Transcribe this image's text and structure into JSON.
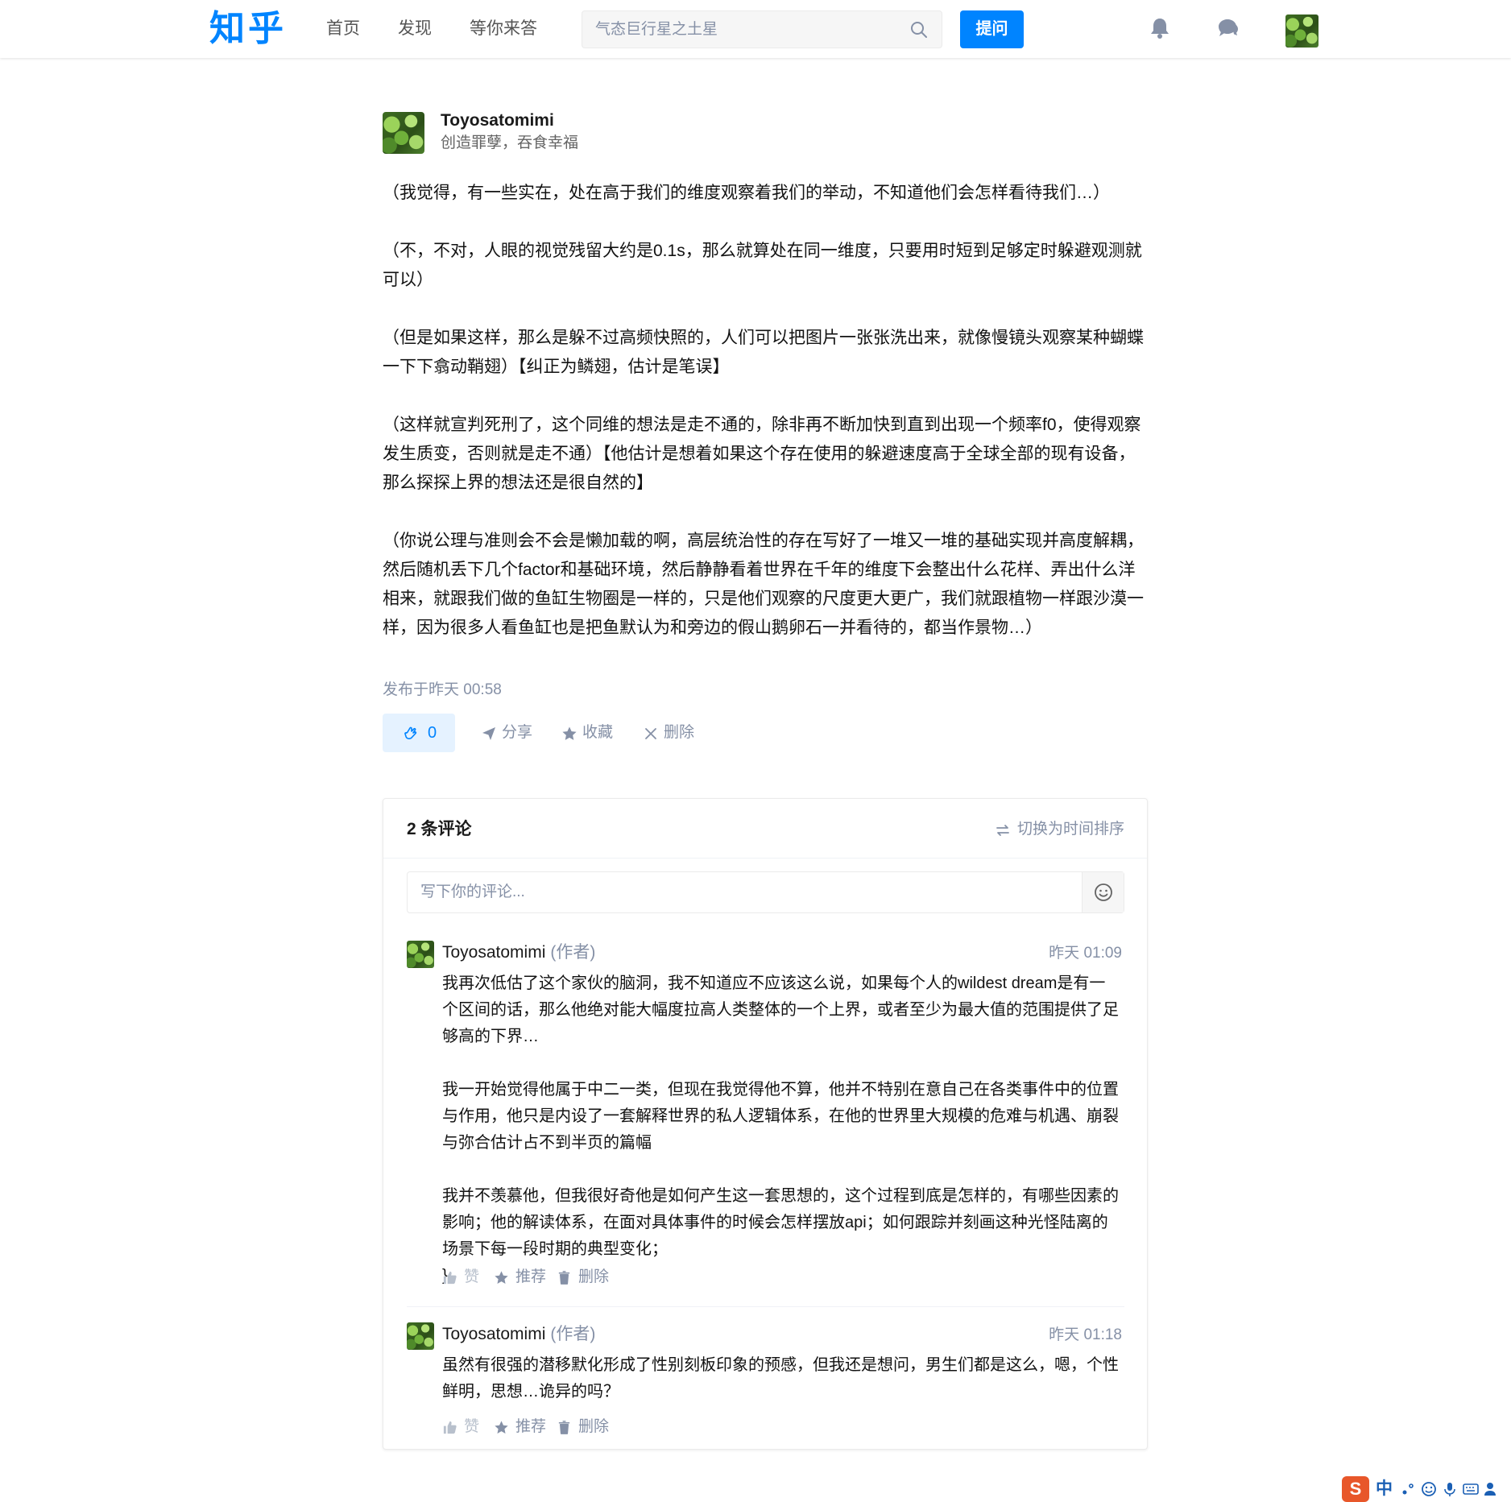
{
  "nav": {
    "logo": "知乎",
    "links": [
      "首页",
      "发现",
      "等你来答"
    ],
    "search_placeholder": "气态巨行星之土星",
    "ask_label": "提问",
    "icons": [
      "bell-icon",
      "chat-icon"
    ]
  },
  "post": {
    "author_name": "Toyosatomimi",
    "author_bio": "创造罪孽，吞食幸福",
    "paragraphs": [
      "（我觉得，有一些实在，处在高于我们的维度观察着我们的举动，不知道他们会怎样看待我们…）",
      "（不，不对，人眼的视觉残留大约是0.1s，那么就算处在同一维度，只要用时短到足够定时躲避观测就可以）",
      "（但是如果这样，那么是躲不过高频快照的，人们可以把图片一张张洗出来，就像慢镜头观察某种蝴蝶一下下翕动鞘翅）【纠正为鳞翅，估计是笔误】",
      "（这样就宣判死刑了，这个同维的想法是走不通的，除非再不断加快到直到出现一个频率f0，使得观察发生质变，否则就是走不通）【他估计是想着如果这个存在使用的躲避速度高于全球全部的现有设备，那么探探上界的想法还是很自然的】",
      "（你说公理与准则会不会是懒加载的啊，高层统治性的存在写好了一堆又一堆的基础实现并高度解耦，然后随机丢下几个factor和基础环境，然后静静看着世界在千年的维度下会整出什么花样、弄出什么洋相来，就跟我们做的鱼缸生物圈是一样的，只是他们观察的尺度更大更广，我们就跟植物一样跟沙漠一样，因为很多人看鱼缸也是把鱼默认为和旁边的假山鹅卵石一并看待的，都当作景物…）"
    ],
    "published": "发布于昨天 00:58",
    "vote_count": "0",
    "actions": {
      "share": "分享",
      "collect": "收藏",
      "delete": "删除"
    }
  },
  "comments": {
    "title": "2 条评论",
    "sort_label": "切换为时间排序",
    "input_placeholder": "写下你的评论...",
    "items": [
      {
        "name": "Toyosatomimi",
        "tag": "(作者)",
        "time": "昨天 01:09",
        "paragraphs": [
          "我再次低估了这个家伙的脑洞，我不知道应不应该这么说，如果每个人的wildest dream是有一个区间的话，那么他绝对能大幅度拉高人类整体的一个上界，或者至少为最大值的范围提供了足够高的下界…",
          "我一开始觉得他属于中二一类，但现在我觉得他不算，他并不特别在意自己在各类事件中的位置与作用，他只是内设了一套解释世界的私人逻辑体系，在他的世界里大规模的危难与机遇、崩裂与弥合估计占不到半页的篇幅",
          "我并不羡慕他，但我很好奇他是如何产生这一套思想的，这个过程到底是怎样的，有哪些因素的影响；他的解读体系，在面对具体事件的时候会怎样摆放api；如何跟踪并刻画这种光怪陆离的场景下每一段时期的典型变化；"
        ],
        "like": "赞",
        "recommend": "推荐",
        "delete": "删除"
      },
      {
        "name": "Toyosatomimi",
        "tag": "(作者)",
        "time": "昨天 01:18",
        "paragraphs": [
          "虽然有很强的潜移默化形成了性别刻板印象的预感，但我还是想问，男生们都是这么，嗯，个性鲜明，思想…诡异的吗？"
        ],
        "like": "赞",
        "recommend": "推荐",
        "delete": "删除"
      }
    ]
  },
  "ime": {
    "logo": "S",
    "mode": "中"
  },
  "colors": {
    "brand": "#0084ff",
    "muted": "#8590a6",
    "vote_bg": "#e5f2ff"
  }
}
